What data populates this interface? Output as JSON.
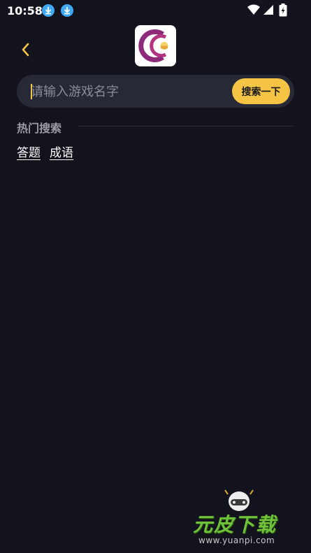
{
  "status_bar": {
    "time": "10:58",
    "icons": [
      "download-icon",
      "download-icon",
      "wifi-icon",
      "signal-icon",
      "battery-charging-icon"
    ]
  },
  "header": {
    "back_icon": "chevron-left-icon",
    "logo": "app-logo-c"
  },
  "search": {
    "placeholder": "请输入游戏名字",
    "value": "",
    "button_label": "搜索一下"
  },
  "hot_search": {
    "title": "热门搜索",
    "tags": [
      "答题",
      "成语"
    ]
  },
  "watermark": {
    "logo_text": "元皮下载",
    "url": "www.yuanpi.com"
  },
  "colors": {
    "background": "#12131c",
    "search_bg": "#272a36",
    "accent_yellow": "#f5c445",
    "logo_purple": "#8e2a7a",
    "muted_text": "#9b9ca5"
  }
}
